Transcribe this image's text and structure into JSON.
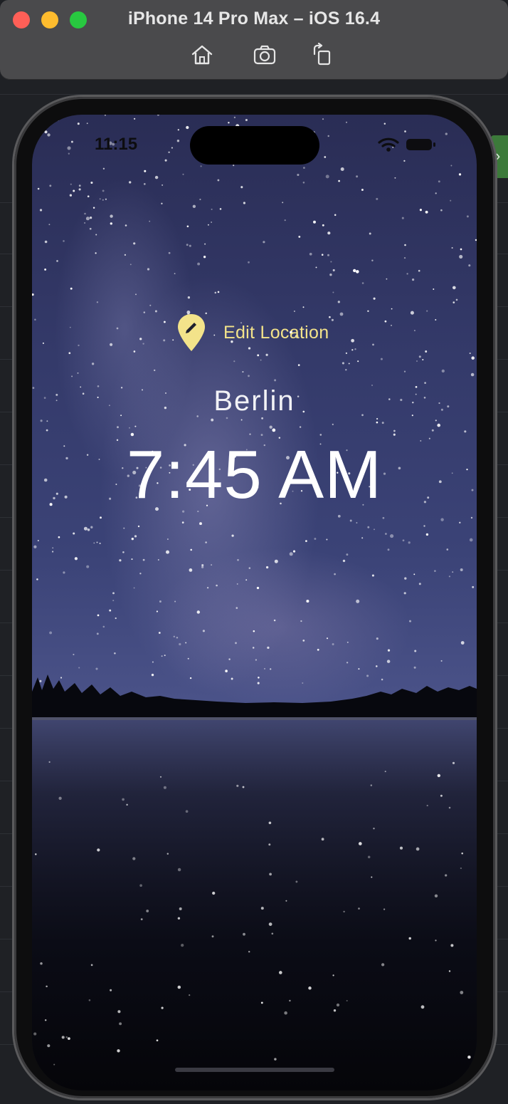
{
  "window": {
    "title": "iPhone 14 Pro Max – iOS 16.4",
    "toolbar": [
      {
        "name": "home",
        "icon": "home-icon"
      },
      {
        "name": "screenshot",
        "icon": "camera-icon"
      },
      {
        "name": "rotate",
        "icon": "rotate-icon"
      }
    ]
  },
  "status_bar": {
    "time": "11:15",
    "icons": [
      "wifi-icon",
      "battery-icon"
    ]
  },
  "app": {
    "edit_location_label": "Edit Location",
    "location_icon": "location-edit-icon",
    "city": "Berlin",
    "time": "7:45 AM",
    "accent_color": "#f3e38a",
    "background": "night sky with milky way over a lake"
  }
}
